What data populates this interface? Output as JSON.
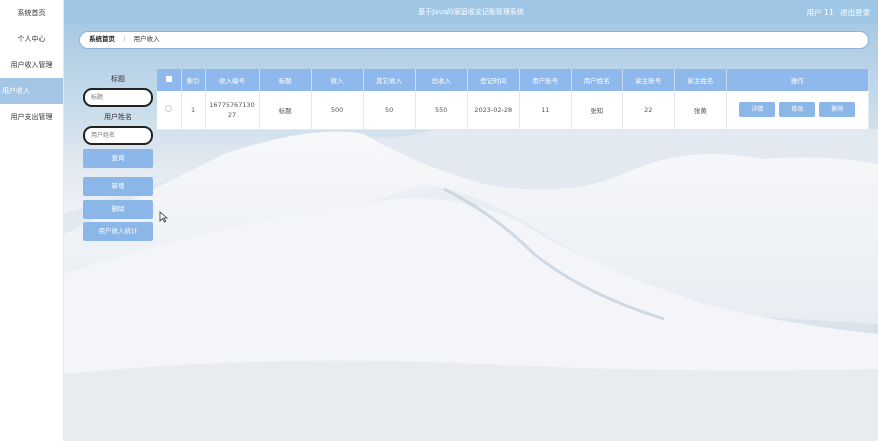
{
  "header": {
    "title": "基于Java的家庭收支记账管理系统",
    "user_label": "用户 11",
    "logout_label": "退出登录"
  },
  "sidebar": {
    "items": [
      {
        "label": "系统首页"
      },
      {
        "label": "个人中心"
      },
      {
        "label": "用户收入管理"
      },
      {
        "label": "用户收入"
      },
      {
        "label": "用户支出管理"
      }
    ]
  },
  "breadcrumb": {
    "home": "系统首页",
    "separator": "⋮",
    "current": "用户收入"
  },
  "search": {
    "title_label": "标题",
    "title_placeholder": "标题",
    "name_label": "用户姓名",
    "name_placeholder": "用户姓名",
    "query_button": "查询",
    "add_button": "新增",
    "delete_button": "删除",
    "stats_button": "用户收入统计"
  },
  "table": {
    "columns": [
      "索引",
      "收入编号",
      "标题",
      "收入",
      "其它收入",
      "总收入",
      "登记时间",
      "用户账号",
      "用户姓名",
      "家主账号",
      "家主姓名",
      "操作"
    ],
    "rows": [
      {
        "index": "1",
        "income_no": "1677576713027",
        "title": "标题",
        "income": "500",
        "other_income": "50",
        "total_income": "550",
        "date": "2023-02-28",
        "user_account": "11",
        "user_name": "张知",
        "head_account": "22",
        "head_name": "张黄"
      }
    ],
    "actions": {
      "detail": "详情",
      "edit": "修改",
      "delete": "删除"
    }
  },
  "colors": {
    "header_bg": "#a0c6e6",
    "button_bg": "#8ab6e8",
    "table_header_bg": "#8fb9ec"
  }
}
